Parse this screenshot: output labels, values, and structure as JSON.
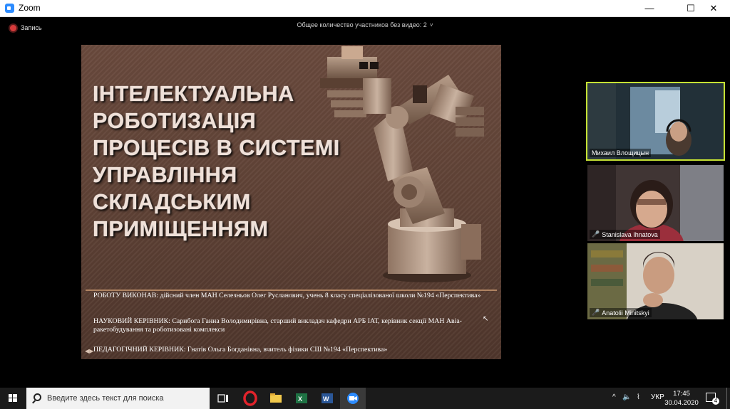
{
  "window": {
    "title": "Zoom",
    "min_glyph": "—",
    "max_glyph": "☐",
    "close_glyph": "✕"
  },
  "zoom_bar": {
    "recording_label": "Запись",
    "no_video_text": "Общее количество участников без видео: 2",
    "no_video_chevron": "˅"
  },
  "slide": {
    "title_lines": [
      "ІНТЕЛЕКТУАЛЬНА",
      "РОБОТИЗАЦІЯ",
      "ПРОЦЕСІВ В СИСТЕМІ",
      "УПРАВЛІННЯ",
      "СКЛАДСЬКИМ",
      "ПРИМІЩЕННЯМ"
    ],
    "author": "РОБОТУ ВИКОНАВ: дійсний член МАН Селезньов Олег Русланович, учень 8 класу спеціалізованої школи №194 «Перспектива»",
    "supervisor": "НАУКОВИЙ КЕРІВНИК: Сарибога Ганна Володимирівна, старший викладач кафедри АРБ ІАТ, керівник секції МАН Авіа-ракетобудування та роботизовані комплекси",
    "teacher": "ПЕДАГОГІЧНИЙ КЕРІВНИК: Гнатів Ольга Богданівна, вчитель фізики СШ №194 «Перспектива»"
  },
  "participants": [
    {
      "name": "Михаил Влощицын",
      "muted": false,
      "active": true
    },
    {
      "name": "Stanislava Ihnatova",
      "muted": true,
      "active": false
    },
    {
      "name": "Anatolii Minitskyi",
      "muted": true,
      "active": false
    }
  ],
  "taskbar": {
    "search_placeholder": "Введите здесь текст для поиска",
    "language": "УКР",
    "time": "17:45",
    "date": "30.04.2020",
    "notification_count": "4"
  },
  "colors": {
    "accent": "#2d8cff",
    "active_speaker": "#c6e234",
    "slide_bg": "#5f4236"
  }
}
